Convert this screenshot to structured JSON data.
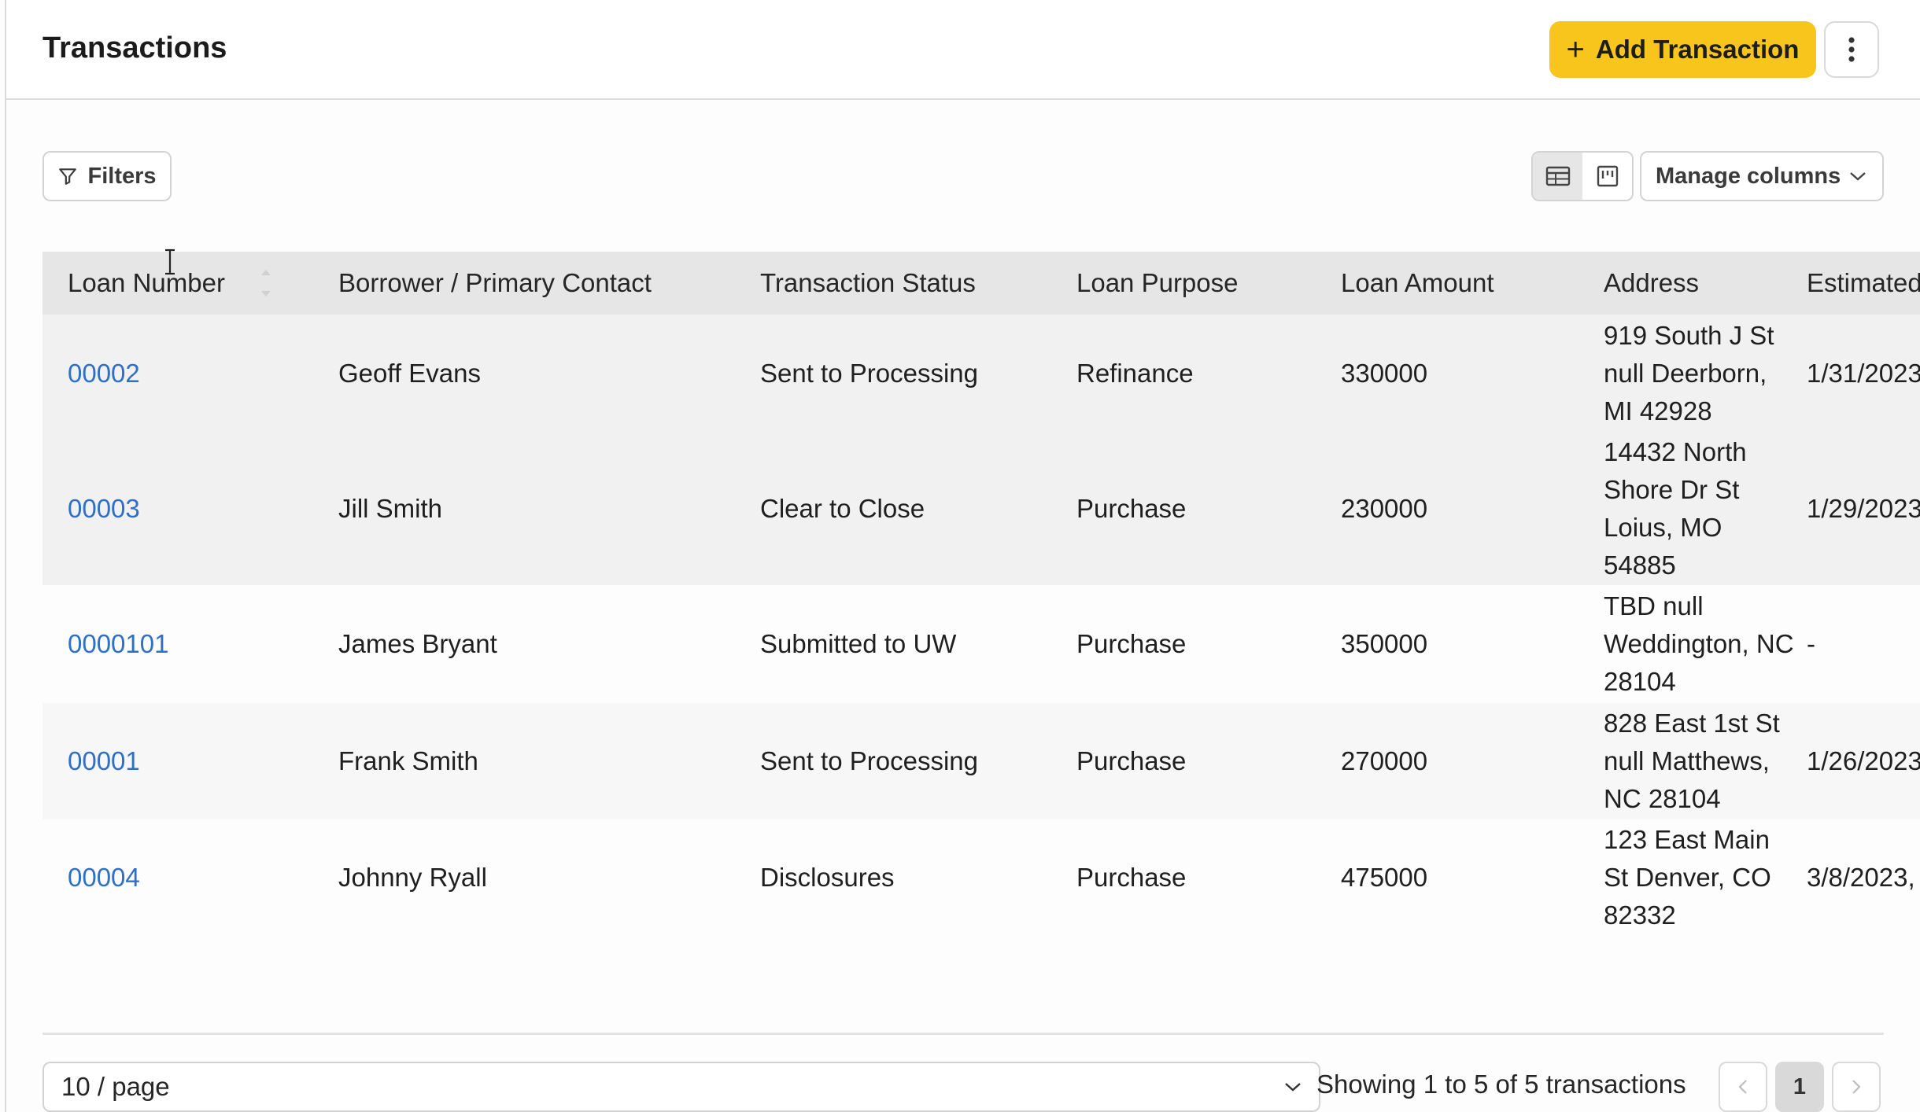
{
  "header": {
    "title": "Transactions",
    "add_button_label": "Add Transaction",
    "add_button_icon": "plus-icon",
    "more_icon": "more-vertical-icon",
    "accent_color": "#f8c51c"
  },
  "toolbar": {
    "filters_label": "Filters",
    "filters_icon": "filter-icon",
    "view_table_icon": "table-view-icon",
    "view_board_icon": "board-view-icon",
    "manage_columns_label": "Manage columns"
  },
  "table": {
    "columns": [
      "Loan Number",
      "Borrower / Primary Contact",
      "Transaction Status",
      "Loan Purpose",
      "Loan Amount",
      "Address",
      "Estimated"
    ],
    "rows": [
      {
        "loan": "00002",
        "borrower": "Geoff Evans",
        "status": "Sent to Processing",
        "purpose": "Refinance",
        "amount": "330000",
        "address": "919 South J St null Deerborn, MI 42928",
        "est": "1/31/2023"
      },
      {
        "loan": "00003",
        "borrower": "Jill Smith",
        "status": "Clear to Close",
        "purpose": "Purchase",
        "amount": "230000",
        "address": "14432 North Shore Dr St Loius, MO 54885",
        "est": "1/29/2023"
      },
      {
        "loan": "0000101",
        "borrower": "James Bryant",
        "status": "Submitted to UW",
        "purpose": "Purchase",
        "amount": "350000",
        "address": "TBD null Weddington, NC 28104",
        "est": "-"
      },
      {
        "loan": "00001",
        "borrower": "Frank Smith",
        "status": "Sent to Processing",
        "purpose": "Purchase",
        "amount": "270000",
        "address": "828 East 1st St null Matthews, NC 28104",
        "est": "1/26/2023"
      },
      {
        "loan": "00004",
        "borrower": "Johnny Ryall",
        "status": "Disclosures",
        "purpose": "Purchase",
        "amount": "475000",
        "address": "123 East Main St Denver, CO 82332",
        "est": "3/8/2023,"
      }
    ]
  },
  "footer": {
    "page_size": "10 / page",
    "showing_text": "Showing 1 to 5 of 5 transactions",
    "current_page": "1",
    "prev_icon": "chevron-left-icon",
    "next_icon": "chevron-right-icon"
  }
}
